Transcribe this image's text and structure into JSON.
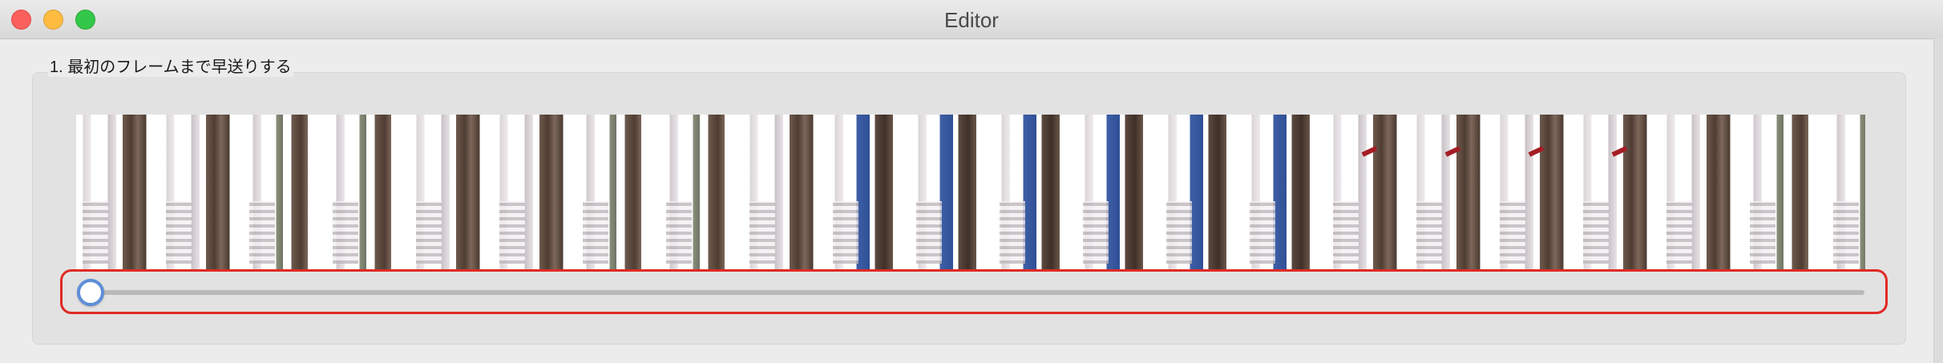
{
  "window": {
    "title": "Editor"
  },
  "section": {
    "label": "1. 最初のフレームまで早送りする"
  },
  "filmstrip": {
    "frame_count": 22,
    "frame_styles": [
      "plain",
      "plain",
      "tree",
      "tree",
      "plain",
      "plain",
      "tree",
      "tree",
      "plain",
      "blue",
      "blue",
      "blue",
      "blue",
      "blue",
      "blue",
      "red",
      "red",
      "red",
      "red",
      "plain",
      "tree",
      "tree"
    ]
  },
  "slider": {
    "value": 0.0,
    "accent_color": "#5d8ed8"
  },
  "highlight": {
    "color": "#e02a25"
  }
}
